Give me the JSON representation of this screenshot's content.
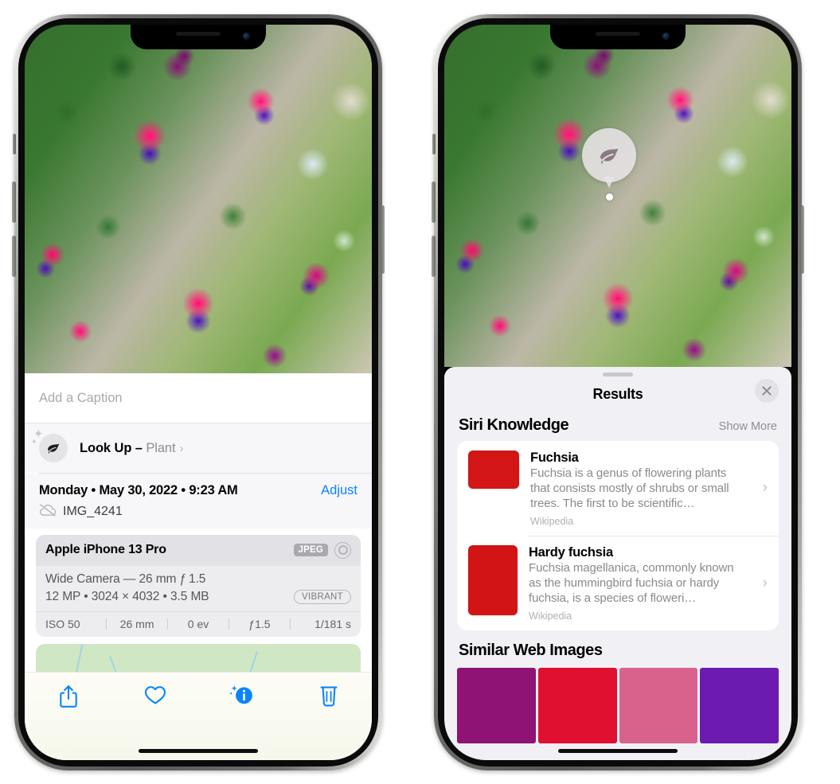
{
  "left_phone": {
    "photo": {
      "alt": "fuchsia-flowers-photo"
    },
    "caption": {
      "placeholder": "Add a Caption",
      "value": ""
    },
    "lookup": {
      "icon": "leaf-icon",
      "label": "Look Up – ",
      "subject": "Plant",
      "chevron": "›"
    },
    "meta": {
      "date": "Monday • May 30, 2022 • 9:23 AM",
      "adjust_label": "Adjust",
      "cloud_icon": "icloud-slash-icon",
      "filename": "IMG_4241"
    },
    "camera_card": {
      "device": "Apple iPhone 13 Pro",
      "format_badge": "JPEG",
      "raw_icon": "raw-circle-icon",
      "lens_line": "Wide Camera — 26 mm ƒ 1.5",
      "size_line": "12 MP • 3024 × 4032 • 3.5 MB",
      "style_badge": "VIBRANT",
      "exif": [
        "ISO 50",
        "26 mm",
        "0 ev",
        "ƒ1.5",
        "1/181 s"
      ]
    },
    "map": {
      "label": "location-map"
    },
    "toolbar": [
      {
        "name": "share-button",
        "icon": "share-icon"
      },
      {
        "name": "favorite-button",
        "icon": "heart-icon"
      },
      {
        "name": "info-button",
        "icon": "info-sparkle-icon"
      },
      {
        "name": "delete-button",
        "icon": "trash-icon"
      }
    ]
  },
  "right_phone": {
    "photo_badge": {
      "icon": "leaf-icon",
      "name": "visual-lookup-leaf-badge"
    },
    "sheet": {
      "title": "Results",
      "close_icon": "close-icon",
      "sections": [
        {
          "title": "Siri Knowledge",
          "action": "Show More",
          "items": [
            {
              "title": "Fuchsia",
              "description": "Fuchsia is a genus of flowering plants that consists mostly of shrubs or small trees. The first to be scientific…",
              "source": "Wikipedia",
              "thumb": "fuchsia-red-flowers-thumb"
            },
            {
              "title": "Hardy fuchsia",
              "description": "Fuchsia magellanica, commonly known as the hummingbird fuchsia or hardy fuchsia, is a species of floweri…",
              "source": "Wikipedia",
              "thumb": "hardy-fuchsia-specimen-thumb"
            }
          ]
        },
        {
          "title": "Similar Web Images",
          "images": [
            "similar-image-1",
            "similar-image-2",
            "similar-image-3",
            "similar-image-4"
          ]
        }
      ]
    }
  },
  "colors": {
    "accent_blue": "#0a84ff",
    "sheet_bg": "#f1f1f5",
    "card_bg": "#ffffff",
    "secondary_text": "#8e8e93"
  }
}
